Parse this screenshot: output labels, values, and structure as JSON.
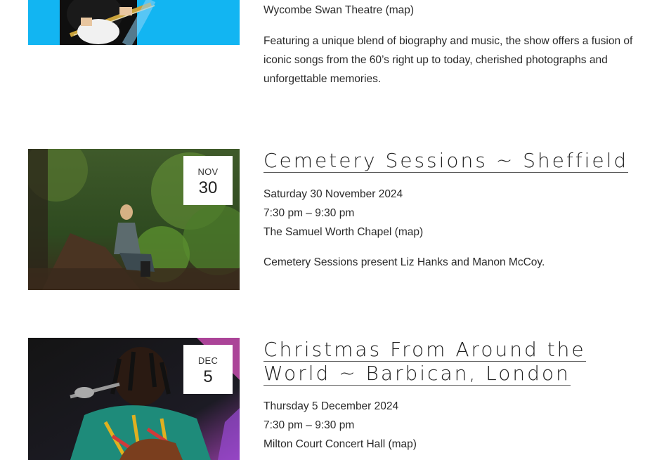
{
  "events": [
    {
      "venue": "Wycombe Swan Theatre (map)",
      "description": "Featuring a unique blend of biography and music, the show offers a fusion of iconic songs from the 60’s right up to today, cherished photographs and unforgettable memories."
    },
    {
      "title": "Cemetery Sessions ~ Sheffield",
      "month": "NOV",
      "day": "30",
      "date": "Saturday 30 November 2024",
      "time": "7:30 pm – 9:30 pm",
      "venue": "The Samuel Worth Chapel (map)",
      "description": "Cemetery Sessions present Liz Hanks and Manon McCoy."
    },
    {
      "title": "Christmas From Around the World ~ Barbican, London",
      "title_line1": "Christmas From Around the",
      "title_line2": "World ~ Barbican, London",
      "month": "DEC",
      "day": "5",
      "date": "Thursday 5 December 2024",
      "time": "7:30 pm – 9:30 pm",
      "venue": "Milton Court Concert Hall (map)"
    }
  ]
}
